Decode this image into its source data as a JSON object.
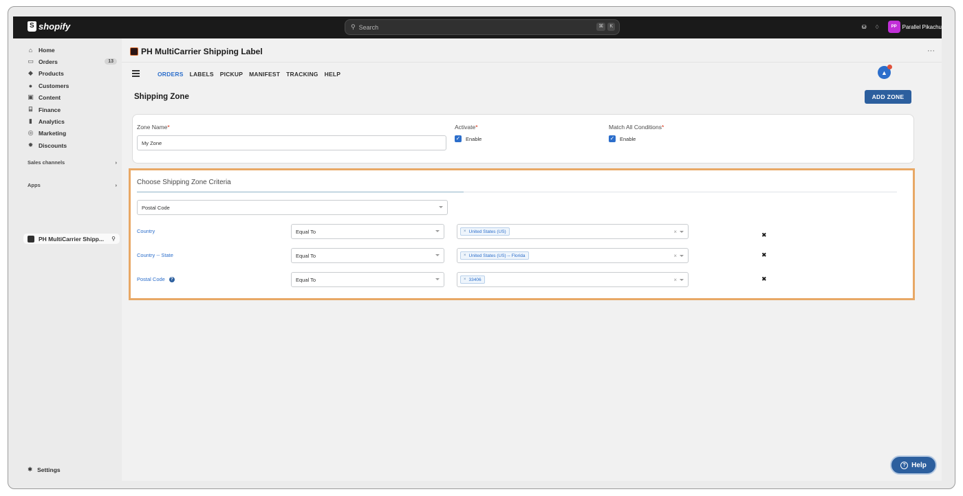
{
  "topbar": {
    "brand": "shopify",
    "search_placeholder": "Search",
    "shortcut_keys": [
      "⌘",
      "K"
    ],
    "user_initials": "PP",
    "user_name": "Parallel Pikachu"
  },
  "sidebar": {
    "items": [
      {
        "label": "Home",
        "icon": "home-icon"
      },
      {
        "label": "Orders",
        "icon": "orders-icon",
        "badge": "13"
      },
      {
        "label": "Products",
        "icon": "tag-icon"
      },
      {
        "label": "Customers",
        "icon": "person-icon"
      },
      {
        "label": "Content",
        "icon": "content-icon"
      },
      {
        "label": "Finance",
        "icon": "bank-icon"
      },
      {
        "label": "Analytics",
        "icon": "bar-chart-icon"
      },
      {
        "label": "Marketing",
        "icon": "target-icon"
      },
      {
        "label": "Discounts",
        "icon": "discount-icon"
      }
    ],
    "sales_channels": "Sales channels",
    "apps": "Apps",
    "app_item": "PH MultiCarrier Shipp...",
    "settings": "Settings"
  },
  "app": {
    "title": "PH MultiCarrier Shipping Label",
    "more": "···",
    "tabs": [
      "ORDERS",
      "LABELS",
      "PICKUP",
      "MANIFEST",
      "TRACKING",
      "HELP"
    ],
    "active_tab": "ORDERS"
  },
  "page": {
    "title": "Shipping Zone",
    "add_zone": "ADD ZONE"
  },
  "zone_form": {
    "zone_name_label": "Zone Name",
    "zone_name_value": "My Zone",
    "activate_label": "Activate",
    "activate_option": "Enable",
    "match_label": "Match All Conditions",
    "match_option": "Enable",
    "required_mark": "*"
  },
  "criteria": {
    "title": "Choose Shipping Zone Criteria",
    "selector_value": "Postal Code",
    "rows": [
      {
        "label": "Country",
        "operator": "Equal To",
        "tag": "United States (US)"
      },
      {
        "label": "Country -- State",
        "operator": "Equal To",
        "tag": "United States (US) -- Florida"
      },
      {
        "label": "Postal Code",
        "operator": "Equal To",
        "tag": "33406"
      }
    ]
  },
  "help_button": "Help",
  "colors": {
    "accent": "#2c6ecb",
    "button": "#2c5f9e",
    "highlight_border": "#e8a865",
    "topbar": "#1a1a1a"
  }
}
